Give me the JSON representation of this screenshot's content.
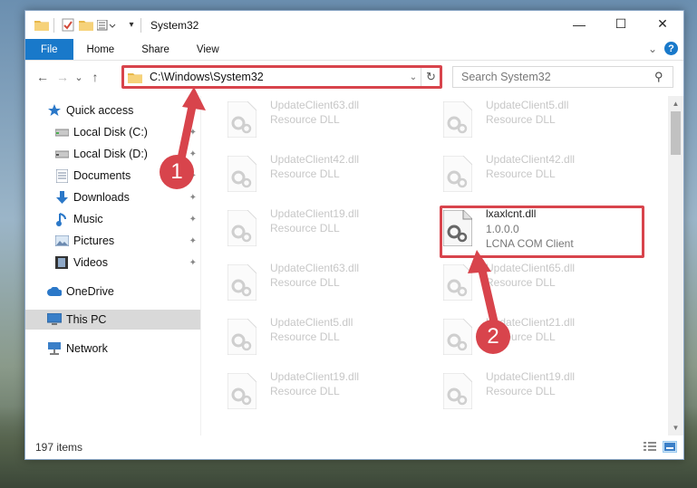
{
  "window": {
    "title": "System32",
    "buttons": {
      "minimize": "—",
      "maximize": "☐",
      "close": "✕"
    }
  },
  "ribbon": {
    "tabs": [
      "File",
      "Home",
      "Share",
      "View"
    ],
    "collapse_glyph": "⌄",
    "help_glyph": "?"
  },
  "navbar": {
    "back_glyph": "←",
    "forward_glyph": "→",
    "recent_glyph": "⌄",
    "up_glyph": "↑",
    "address_path": "C:\\Windows\\System32",
    "search_placeholder": "Search System32"
  },
  "sidebar": {
    "items": [
      {
        "label": "Quick access",
        "icon": "star-icon",
        "pinned": false
      },
      {
        "label": "Local Disk (C:)",
        "icon": "drive-icon",
        "pinned": true
      },
      {
        "label": "Local Disk (D:)",
        "icon": "drive-icon",
        "pinned": true
      },
      {
        "label": "Documents",
        "icon": "documents-icon",
        "pinned": true
      },
      {
        "label": "Downloads",
        "icon": "download-icon",
        "pinned": true
      },
      {
        "label": "Music",
        "icon": "music-icon",
        "pinned": true
      },
      {
        "label": "Pictures",
        "icon": "pictures-icon",
        "pinned": true
      },
      {
        "label": "Videos",
        "icon": "videos-icon",
        "pinned": true
      },
      {
        "label": "OneDrive",
        "icon": "cloud-icon",
        "pinned": false
      },
      {
        "label": "This PC",
        "icon": "computer-icon",
        "pinned": false,
        "selected": true
      },
      {
        "label": "Network",
        "icon": "network-icon",
        "pinned": false
      }
    ],
    "pin_glyph": "📌"
  },
  "files": {
    "left_column": [
      {
        "name": "UpdateClient63.dll",
        "desc": "Resource DLL"
      },
      {
        "name": "UpdateClient42.dll",
        "desc": "Resource DLL"
      },
      {
        "name": "UpdateClient19.dll",
        "desc": "Resource DLL"
      },
      {
        "name": "UpdateClient63.dll",
        "desc": "Resource DLL"
      },
      {
        "name": "UpdateClient5.dll",
        "desc": "Resource DLL"
      },
      {
        "name": "UpdateClient19.dll",
        "desc": "Resource DLL"
      }
    ],
    "right_column": [
      {
        "name": "UpdateClient5.dll",
        "desc": "Resource DLL"
      },
      {
        "name": "UpdateClient42.dll",
        "desc": "Resource DLL"
      },
      {
        "name": "UpdateClient65.dll",
        "desc": "Resource DLL"
      },
      {
        "name": "UpdateClient21.dll",
        "desc": "Resource DLL"
      },
      {
        "name": "UpdateClient19.dll",
        "desc": "Resource DLL"
      }
    ],
    "target": {
      "name": "lxaxlcnt.dll",
      "version": "1.0.0.0",
      "company": "LCNA COM Client"
    }
  },
  "status": {
    "item_count": "197 items"
  },
  "annotations": {
    "step1": "1",
    "step2": "2",
    "color": "#d8444c"
  }
}
